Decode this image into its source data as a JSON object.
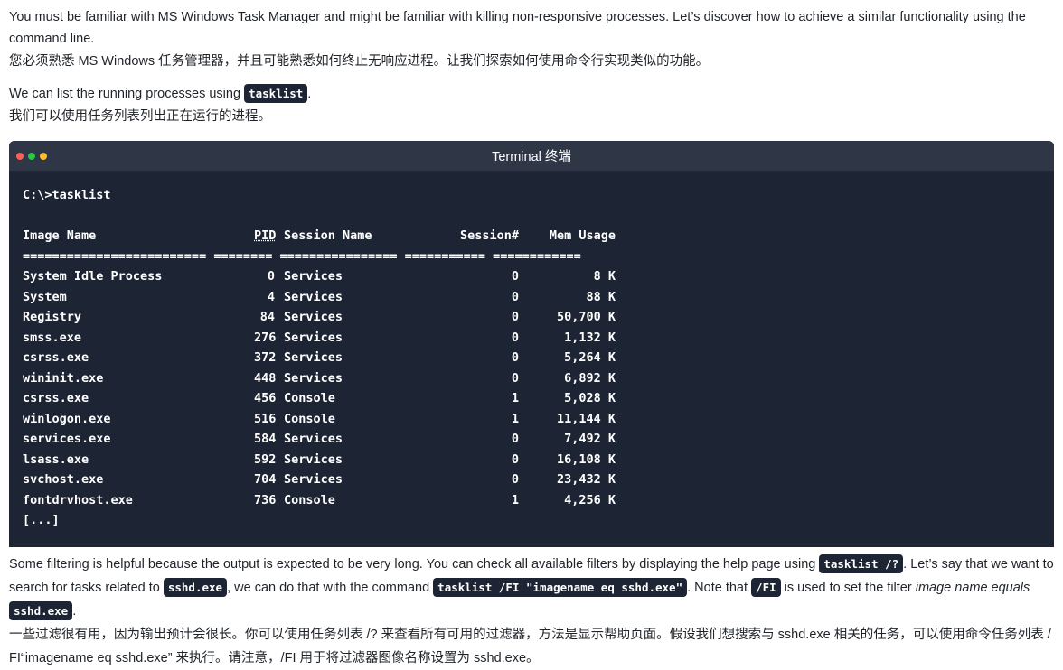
{
  "intro": {
    "en": "You must be familiar with MS Windows Task Manager and might be familiar with killing non-responsive processes. Let’s discover how to achieve a similar functionality using the command line.",
    "zh": "您必须熟悉 MS Windows 任务管理器，并且可能熟悉如何终止无响应进程。让我们探索如何使用命令行实现类似的功能。"
  },
  "list_intro": {
    "en_before": "We can list the running processes using ",
    "code": "tasklist",
    "en_after": ".",
    "zh": "我们可以使用任务列表列出正在运行的进程。"
  },
  "terminal": {
    "title": "Terminal  终端",
    "command": "C:\\>tasklist",
    "headers": {
      "image": "Image Name",
      "pid": "PID",
      "session": "Session Name",
      "session_num": "Session#",
      "mem": "Mem Usage"
    },
    "separator": "========================= ======== ================ =========== ============",
    "rows": [
      {
        "image": "System Idle Process",
        "pid": "0",
        "session": "Services",
        "snum": "0",
        "mem": "8 K"
      },
      {
        "image": "System",
        "pid": "4",
        "session": "Services",
        "snum": "0",
        "mem": "88 K"
      },
      {
        "image": "Registry",
        "pid": "84",
        "session": "Services",
        "snum": "0",
        "mem": "50,700 K"
      },
      {
        "image": "smss.exe",
        "pid": "276",
        "session": "Services",
        "snum": "0",
        "mem": "1,132 K"
      },
      {
        "image": "csrss.exe",
        "pid": "372",
        "session": "Services",
        "snum": "0",
        "mem": "5,264 K"
      },
      {
        "image": "wininit.exe",
        "pid": "448",
        "session": "Services",
        "snum": "0",
        "mem": "6,892 K"
      },
      {
        "image": "csrss.exe",
        "pid": "456",
        "session": "Console",
        "snum": "1",
        "mem": "5,028 K"
      },
      {
        "image": "winlogon.exe",
        "pid": "516",
        "session": "Console",
        "snum": "1",
        "mem": "11,144 K"
      },
      {
        "image": "services.exe",
        "pid": "584",
        "session": "Services",
        "snum": "0",
        "mem": "7,492 K"
      },
      {
        "image": "lsass.exe",
        "pid": "592",
        "session": "Services",
        "snum": "0",
        "mem": "16,108 K"
      },
      {
        "image": "svchost.exe",
        "pid": "704",
        "session": "Services",
        "snum": "0",
        "mem": "23,432 K"
      },
      {
        "image": "fontdrvhost.exe",
        "pid": "736",
        "session": "Console",
        "snum": "1",
        "mem": "4,256 K"
      }
    ],
    "ellipsis": "[...]"
  },
  "filter_para": {
    "t1": "Some filtering is helpful because the output is expected to be very long. You can check all available filters by displaying the help page using ",
    "code1": "tasklist /?",
    "t2": ". Let’s say that we want to search for tasks related to ",
    "code2": "sshd.exe",
    "t3": ", we can do that with the command ",
    "code3": "tasklist /FI \"imagename eq sshd.exe\"",
    "t4": ". Note that ",
    "code4": "/FI",
    "t5": " is used to set the filter ",
    "em": "image name equals",
    "t6": " ",
    "code5": "sshd.exe",
    "t7": ".",
    "zh": "一些过滤很有用，因为输出预计会很长。你可以使用任务列表 /? 来查看所有可用的过滤器，方法是显示帮助页面。假设我们想搜索与 sshd.exe 相关的任务，可以使用命令任务列表 / FI“imagename eq sshd.exe” 来执行。请注意，/FI 用于将过滤器图像名称设置为 sshd.exe。"
  }
}
